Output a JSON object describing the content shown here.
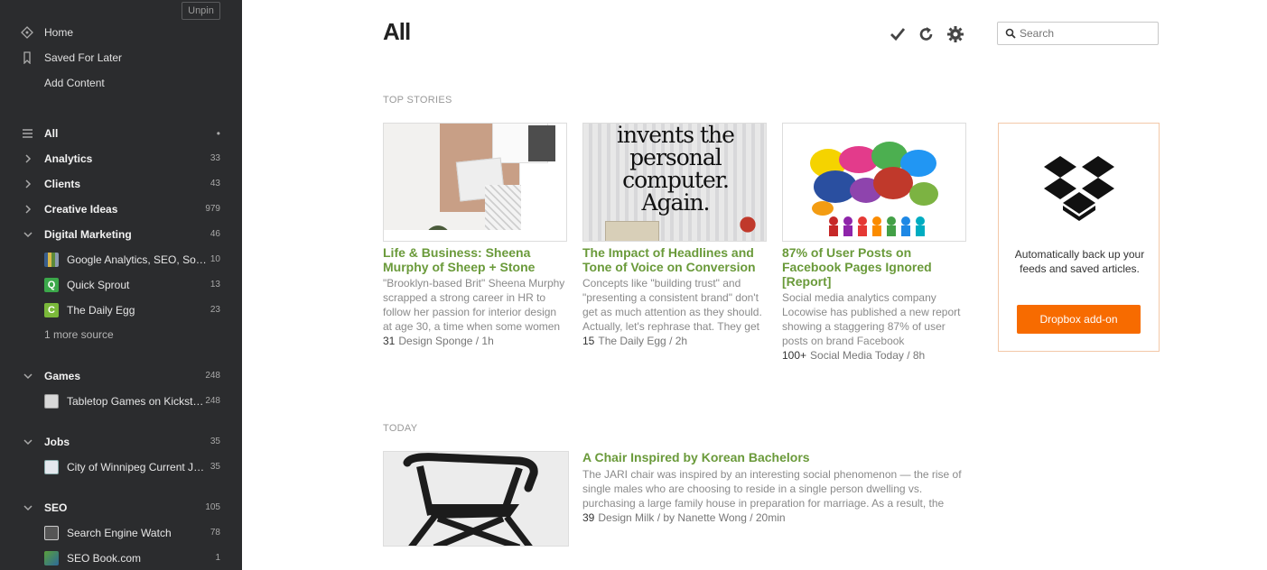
{
  "sidebar": {
    "unpin_label": "Unpin",
    "nav": [
      {
        "label": "Home",
        "icon": "home-icon"
      },
      {
        "label": "Saved For Later",
        "icon": "bookmark-icon"
      },
      {
        "label": "Add Content",
        "icon": ""
      }
    ],
    "all": {
      "label": "All",
      "indicator": "•"
    },
    "categories": [
      {
        "label": "Analytics",
        "count": "33",
        "expanded": false
      },
      {
        "label": "Clients",
        "count": "43",
        "expanded": false
      },
      {
        "label": "Creative Ideas",
        "count": "979",
        "expanded": false
      },
      {
        "label": "Digital Marketing",
        "count": "46",
        "expanded": true
      },
      {
        "label": "Games",
        "count": "248",
        "expanded": true
      },
      {
        "label": "Jobs",
        "count": "35",
        "expanded": true
      },
      {
        "label": "SEO",
        "count": "105",
        "expanded": true
      }
    ],
    "feeds": [
      {
        "label": "Google Analytics, SEO, Social Media, Digital Marketing",
        "count": "10"
      },
      {
        "label": "Quick Sprout",
        "count": "13"
      },
      {
        "label": "The Daily Egg",
        "count": "23"
      },
      {
        "label": "Tabletop Games on Kickstarter",
        "count": "248"
      },
      {
        "label": "City of Winnipeg Current Job Opportunities",
        "count": "35"
      },
      {
        "label": "Search Engine Watch",
        "count": "78"
      },
      {
        "label": "SEO Book.com",
        "count": "1"
      }
    ],
    "more_source": "1 more source"
  },
  "header": {
    "title": "All",
    "search_placeholder": "Search"
  },
  "sections": {
    "top_stories": "TOP STORIES",
    "today": "TODAY"
  },
  "top_stories": [
    {
      "title": "Life & Business: Sheena Murphy of Sheep + Stone",
      "desc": "\"Brooklyn-based Brit\" Sheena Murphy scrapped a strong career in HR to follow her passion for interior design at age 30, a time when some women find themselves settling down rather",
      "count": "31",
      "source": "Design Sponge / 1h"
    },
    {
      "title": "The Impact of Headlines and Tone of Voice on Conversion",
      "desc": "Concepts like \"building trust\" and \"presenting a consistent brand\" don't get as much attention as they should. Actually, let's rephrase that. They get lots of attention but—while many",
      "count": "15",
      "source": "The Daily Egg / 2h",
      "image_text": [
        "invents the",
        "personal",
        "computer.",
        "Again."
      ]
    },
    {
      "title": "87% of User Posts on Facebook Pages Ignored [Report]",
      "desc": "Social media analytics company Locowise has published a new report showing a staggering 87% of user posts on brand Facebook",
      "count": "100+",
      "source": "Social Media Today / 8h"
    }
  ],
  "dropbox": {
    "text": "Automatically back up your feeds and saved articles.",
    "button": "Dropbox add-on"
  },
  "today": {
    "title": "A Chair Inspired by Korean Bachelors",
    "desc": "The JARI chair was inspired by an interesting social phenomenon — the rise of single males who are choosing to reside in a single person dwelling vs. purchasing a large family house in preparation for marriage. As a result, the",
    "count": "39",
    "source": "Design Milk / by Nanette Wong / 20min"
  },
  "colors": {
    "sidebar_bg": "#2b2c2e",
    "title_green": "#6a9a3a",
    "dropbox_orange": "#f76b00"
  }
}
